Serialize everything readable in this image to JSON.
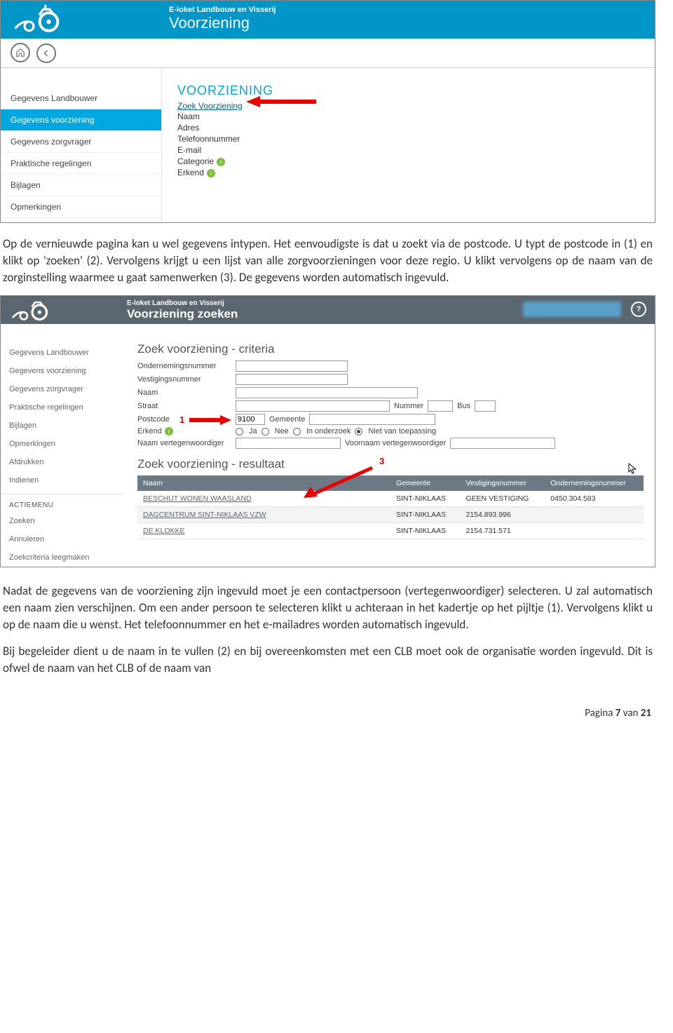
{
  "shot1": {
    "header_small": "E-loket Landbouw en Visserij",
    "header_big": "Voorziening",
    "sidebar": [
      "Gegevens Landbouwer",
      "Gegevens voorziening",
      "Gegevens zorgvrager",
      "Praktische regelingen",
      "Bijlagen",
      "Opmerkingen"
    ],
    "title": "VOORZIENING",
    "link": "Zoek Voorziening",
    "fields": [
      "Naam",
      "Adres",
      "Telefoonnummer",
      "E-mail",
      "Categorie",
      "Erkend"
    ]
  },
  "para1": "Op de vernieuwde pagina kan u wel gegevens intypen. Het eenvoudigste is dat u zoekt via de postcode. U typt de postcode in (1) en klikt op 'zoeken' (2). Vervolgens krijgt u een lijst van alle zorgvoorzieningen voor deze regio. U klikt vervolgens op de naam van de zorginstelling waarmee u gaat samenwerken (3). De gegevens worden automatisch ingevuld.",
  "shot2": {
    "header_small": "E-loket Landbouw en Visserij",
    "header_big": "Voorziening zoeken",
    "sidebar": [
      "Gegevens Landbouwer",
      "Gegevens voorziening",
      "Gegevens zorgvrager",
      "Praktische regelingen",
      "Bijlagen",
      "Opmerkingen",
      "Afdrukken",
      "Indienen"
    ],
    "actiemenu_title": "ACTIEMENU",
    "actiemenu": [
      "Zoeken",
      "Annuleren",
      "Zoekcriteria leegmaken"
    ],
    "criteria_title": "Zoek voorziening - criteria",
    "criteria_labels": {
      "onr": "Ondernemingsnummer",
      "vest": "Vestigingsnummer",
      "naam": "Naam",
      "straat": "Straat",
      "nummer": "Nummer",
      "bus": "Bus",
      "postcode": "Postcode",
      "gemeente": "Gemeente",
      "erkend": "Erkend",
      "ja": "Ja",
      "nee": "Nee",
      "onderzoek": "In onderzoek",
      "nvt": "Niet van toepassing",
      "naam_vert": "Naam vertegenwoordiger",
      "voornaam_vert": "Voornaam vertegenwoordiger"
    },
    "postcode_value": "9100",
    "result_title": "Zoek voorziening - resultaat",
    "result_headers": [
      "Naam",
      "Gemeente",
      "Vestigingsnummer",
      "Ondernemingsnummer"
    ],
    "result_rows": [
      [
        "BESCHUT WONEN WAASLAND",
        "SINT-NIKLAAS",
        "GEEN VESTIGING",
        "0450.304.583"
      ],
      [
        "DAGCENTRUM SINT-NIKLAAS VZW",
        "SINT-NIKLAAS",
        "2154.893.996",
        ""
      ],
      [
        "DE KLOKKE",
        "SINT-NIKLAAS",
        "2154.731.571",
        ""
      ]
    ]
  },
  "para2": "Nadat de gegevens van de voorziening zijn ingevuld moet je een contactpersoon (vertegenwoordiger) selecteren. U zal automatisch een naam zien verschijnen. Om een ander persoon te selecteren klikt u achteraan in het kadertje op het pijltje (1). Vervolgens  klikt u  op de naam die u wenst.  Het telefoonnummer en het e-mailadres worden automatisch ingevuld.",
  "para3": "Bij begeleider dient u de naam in te vullen (2) en bij overeenkomsten met een CLB moet ook de organisatie worden ingevuld. Dit is ofwel de naam van het CLB of de naam van",
  "footer": {
    "pre": "Pagina ",
    "num": "7",
    "mid": " van ",
    "total": "21"
  }
}
